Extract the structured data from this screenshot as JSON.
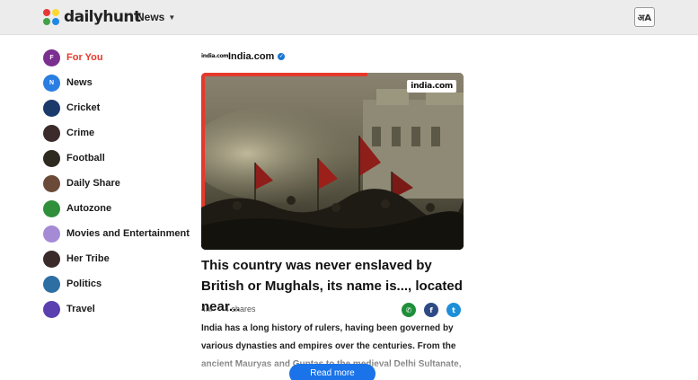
{
  "header": {
    "logo_text": "dailyhunt",
    "nav_news_label": "News",
    "language_icon": "language-translate-icon",
    "language_glyph": "अA"
  },
  "sidebar": {
    "items": [
      {
        "label": "For You",
        "icon": "for-you-icon",
        "badge": "F",
        "color": "#7b2f8f",
        "active": true
      },
      {
        "label": "News",
        "icon": "news-icon",
        "badge": "N",
        "color": "#2a7de1",
        "active": false
      },
      {
        "label": "Cricket",
        "icon": "cricket-icon",
        "badge": "",
        "color": "#1b3a6b",
        "active": false
      },
      {
        "label": "Crime",
        "icon": "crime-icon",
        "badge": "",
        "color": "#3b2b2b",
        "active": false
      },
      {
        "label": "Football",
        "icon": "football-icon",
        "badge": "",
        "color": "#2e2a20",
        "active": false
      },
      {
        "label": "Daily Share",
        "icon": "daily-share-icon",
        "badge": "",
        "color": "#6b4a3a",
        "active": false
      },
      {
        "label": "Autozone",
        "icon": "autozone-icon",
        "badge": "",
        "color": "#2f8f3a",
        "active": false
      },
      {
        "label": "Movies and Entertainment",
        "icon": "movies-icon",
        "badge": "",
        "color": "#a58ad6",
        "active": false
      },
      {
        "label": "Her Tribe",
        "icon": "her-tribe-icon",
        "badge": "",
        "color": "#3a2a2a",
        "active": false
      },
      {
        "label": "Politics",
        "icon": "politics-icon",
        "badge": "",
        "color": "#2d6fa3",
        "active": false
      },
      {
        "label": "Travel",
        "icon": "travel-icon",
        "badge": "",
        "color": "#5a3fb0",
        "active": false
      }
    ]
  },
  "article": {
    "source_logo": "india.com",
    "source_name": "India.com",
    "image_badge": "india.com",
    "headline": "This country was never enslaved by British or Mughals, its name is..., located near...",
    "age": "4hr",
    "shares": "4 shares",
    "summary": "India has a long history of rulers, having been governed by various dynasties and empires over the centuries. From the ancient Mauryas and Guptas to the medieval Delhi Sultanate,",
    "read_more_label": "Read more"
  },
  "colors": {
    "accent_active": "#e5392c",
    "read_more": "#1a73e8",
    "whatsapp": "#1f8f3a",
    "facebook": "#2d4a85",
    "twitter": "#1d8fd8"
  }
}
